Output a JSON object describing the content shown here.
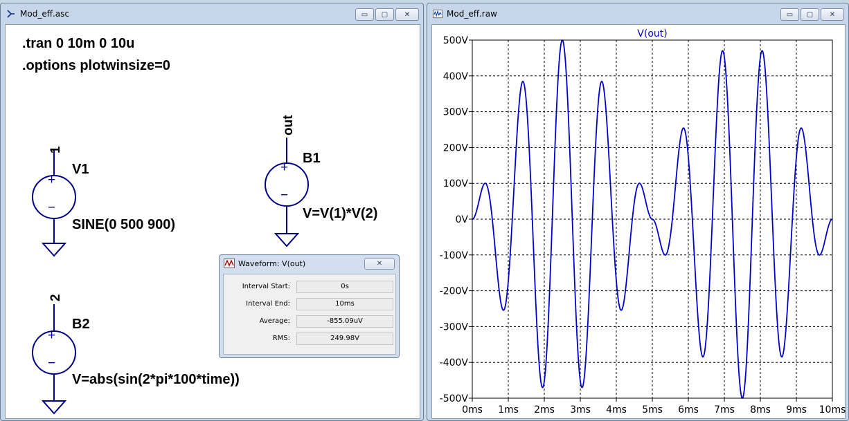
{
  "schematic_window": {
    "title": "Mod_eff.asc",
    "controls": {
      "minimize": "▭",
      "maximize": "▢",
      "close": "✕"
    }
  },
  "plot_window": {
    "title": "Mod_eff.raw",
    "controls": {
      "minimize": "▭",
      "maximize": "▢",
      "close": "✕"
    }
  },
  "schematic": {
    "directives": [
      ".tran 0 10m 0 10u",
      ".options plotwinsize=0"
    ],
    "components": [
      {
        "name": "V1",
        "value": "SINE(0 500 900)",
        "net": "1"
      },
      {
        "name": "B1",
        "value": "V=V(1)*V(2)",
        "net": "out"
      },
      {
        "name": "B2",
        "value": "V=abs(sin(2*pi*100*time))",
        "net": "2"
      }
    ],
    "plus_sign": "+",
    "minus_sign": "−"
  },
  "waveform_dialog": {
    "title": "Waveform: V(out)",
    "close_label": "✕",
    "rows": [
      {
        "label": "Interval Start:",
        "value": "0s"
      },
      {
        "label": "Interval End:",
        "value": "10ms"
      },
      {
        "label": "Average:",
        "value": "-855.09uV"
      },
      {
        "label": "RMS:",
        "value": "249.98V"
      }
    ]
  },
  "colors": {
    "trace": "#0000cc",
    "grid": "#000000",
    "title_text": "#0000cc",
    "window_frame": "#c7d6ea"
  },
  "chart_data": {
    "type": "line",
    "title": "V(out)",
    "xlabel": "",
    "ylabel": "",
    "xlim": [
      0,
      10
    ],
    "ylim": [
      -500,
      500
    ],
    "x_ticks": [
      0,
      1,
      2,
      3,
      4,
      5,
      6,
      7,
      8,
      9,
      10
    ],
    "x_tick_labels": [
      "0ms",
      "1ms",
      "2ms",
      "3ms",
      "4ms",
      "5ms",
      "6ms",
      "7ms",
      "8ms",
      "9ms",
      "10ms"
    ],
    "y_ticks": [
      500,
      400,
      300,
      200,
      100,
      0,
      -100,
      -200,
      -300,
      -400,
      -500
    ],
    "y_tick_labels": [
      "500V",
      "400V",
      "300V",
      "200V",
      "100V",
      "0V",
      "-100V",
      "-200V",
      "-300V",
      "-400V",
      "-500V"
    ],
    "grid": true,
    "x_unit": "ms",
    "series": [
      {
        "name": "V(out)",
        "formula": "500*sin(2*pi*900*t)*abs(sin(2*pi*100*t))",
        "sample_step_ms": 0.005
      }
    ]
  }
}
